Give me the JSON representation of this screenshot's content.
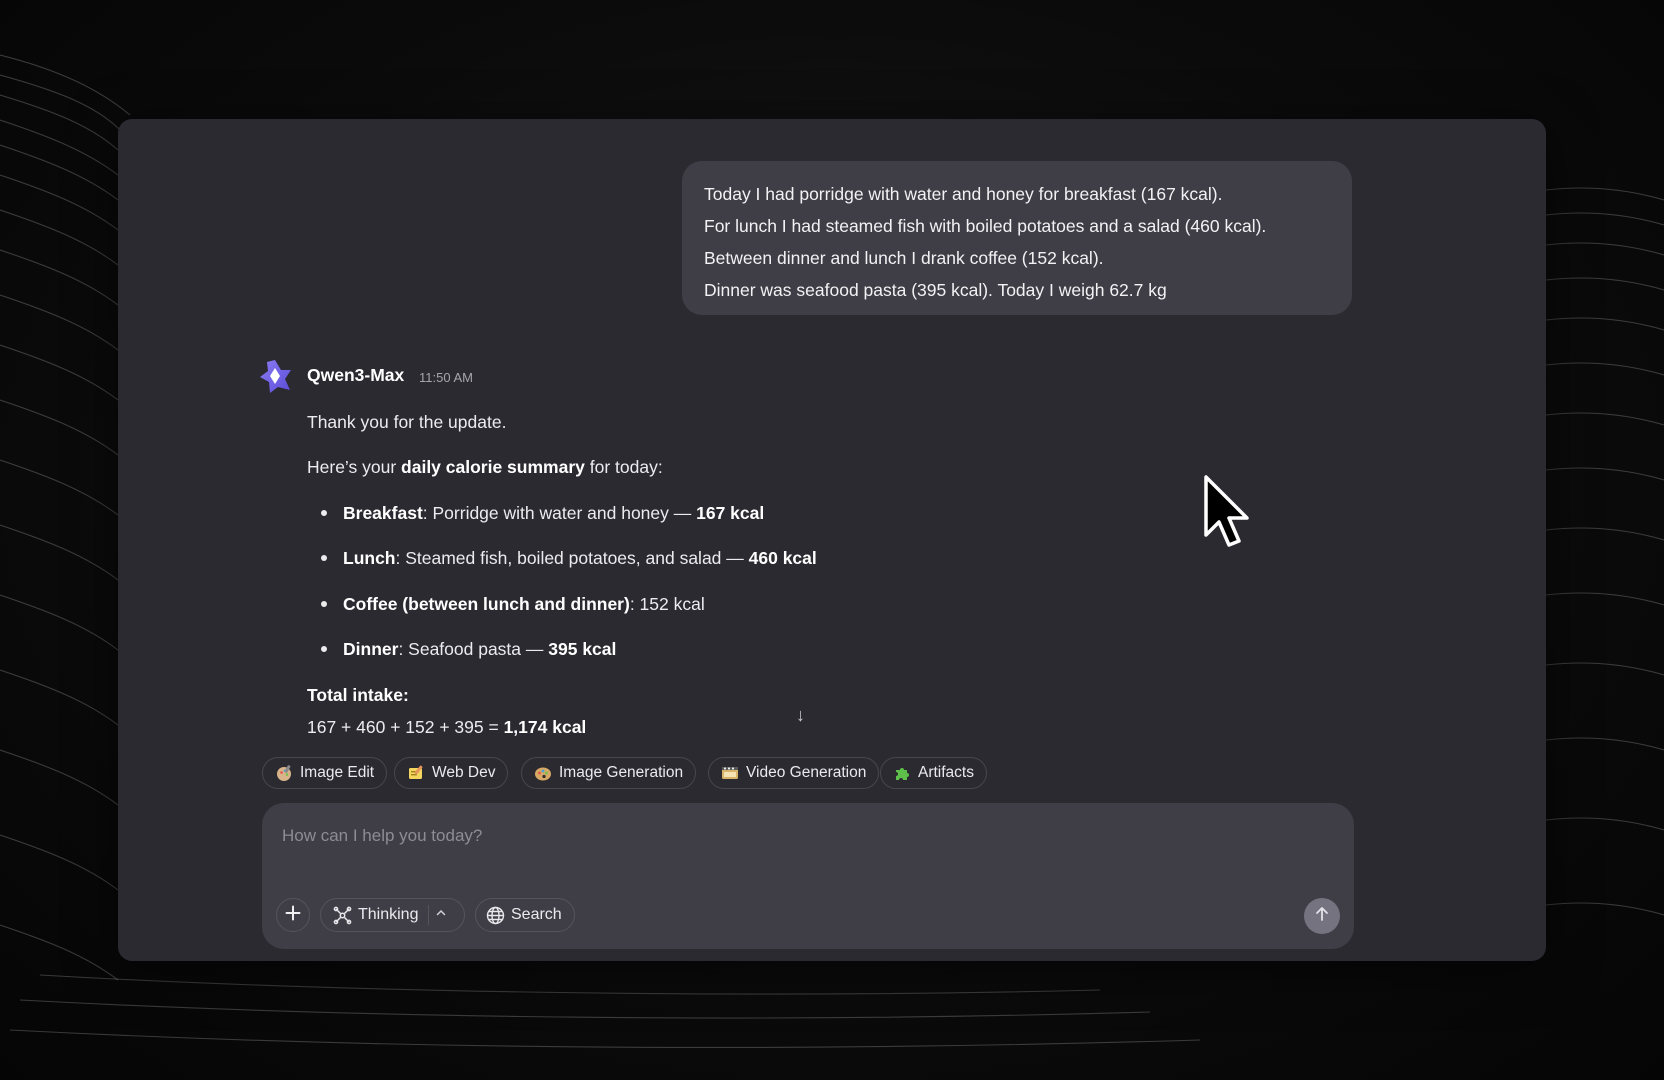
{
  "user_message": {
    "lines": [
      "Today I had porridge with water and honey for breakfast (167 kcal).",
      "For lunch I had steamed fish with boiled potatoes and a salad (460 kcal).",
      "Between dinner and lunch I drank coffee (152 kcal).",
      "Dinner was seafood pasta (395 kcal). Today I weigh 62.7 kg"
    ]
  },
  "assistant": {
    "name": "Qwen3-Max",
    "time": "11:50 AM",
    "intro": "Thank you for the update.",
    "summary_prefix": "Here’s your ",
    "summary_bold": "daily calorie summary",
    "summary_suffix": " for today:",
    "items": [
      {
        "bold": "Breakfast",
        "text": ": Porridge with water and honey — ",
        "value": "167 kcal"
      },
      {
        "bold": "Lunch",
        "text": ": Steamed fish, boiled potatoes, and salad — ",
        "value": "460 kcal"
      },
      {
        "bold": "Coffee (between lunch and dinner)",
        "text": ": 152 kcal",
        "value": ""
      },
      {
        "bold": "Dinner",
        "text": ": Seafood pasta — ",
        "value": "395 kcal"
      }
    ],
    "total_label": "Total intake:",
    "total_formula": "167 + 460 + 152 + 395 = ",
    "total_value": "1,174 kcal"
  },
  "scroll_down_glyph": "↓",
  "feature_chips": [
    {
      "label": "Image Edit",
      "icon": "image-edit-icon"
    },
    {
      "label": "Web Dev",
      "icon": "web-dev-icon"
    },
    {
      "label": "Image Generation",
      "icon": "palette-icon"
    },
    {
      "label": "Video Generation",
      "icon": "film-icon"
    },
    {
      "label": "Artifacts",
      "icon": "puzzle-icon"
    }
  ],
  "composer": {
    "placeholder": "How can I help you today?",
    "thinking_label": "Thinking",
    "search_label": "Search"
  },
  "colors": {
    "window_bg": "#2b2a31",
    "bubble_bg": "#3f3e46",
    "accent": "#6c5ce7"
  }
}
